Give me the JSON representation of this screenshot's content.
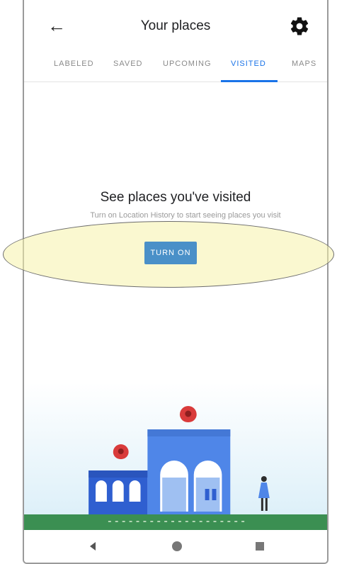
{
  "header": {
    "title": "Your places"
  },
  "icons": {
    "back": "arrow-back-icon",
    "settings": "gear-icon",
    "nav_back": "triangle-back-icon",
    "nav_home": "circle-home-icon",
    "nav_recents": "square-recents-icon"
  },
  "tabs": [
    {
      "label": "LABELED",
      "active": false
    },
    {
      "label": "SAVED",
      "active": false
    },
    {
      "label": "UPCOMING",
      "active": false
    },
    {
      "label": "VISITED",
      "active": true
    },
    {
      "label": "MAPS",
      "active": false
    }
  ],
  "empty_state": {
    "title": "See places you've visited",
    "description": "Turn on Location History to start seeing places you visit",
    "button_label": "TURN ON"
  },
  "colors": {
    "accent": "#1a73e8",
    "button": "#4a90c8",
    "pin": "#d93b3b",
    "grass": "#3b8f52",
    "highlight": "#f5f2aa"
  }
}
